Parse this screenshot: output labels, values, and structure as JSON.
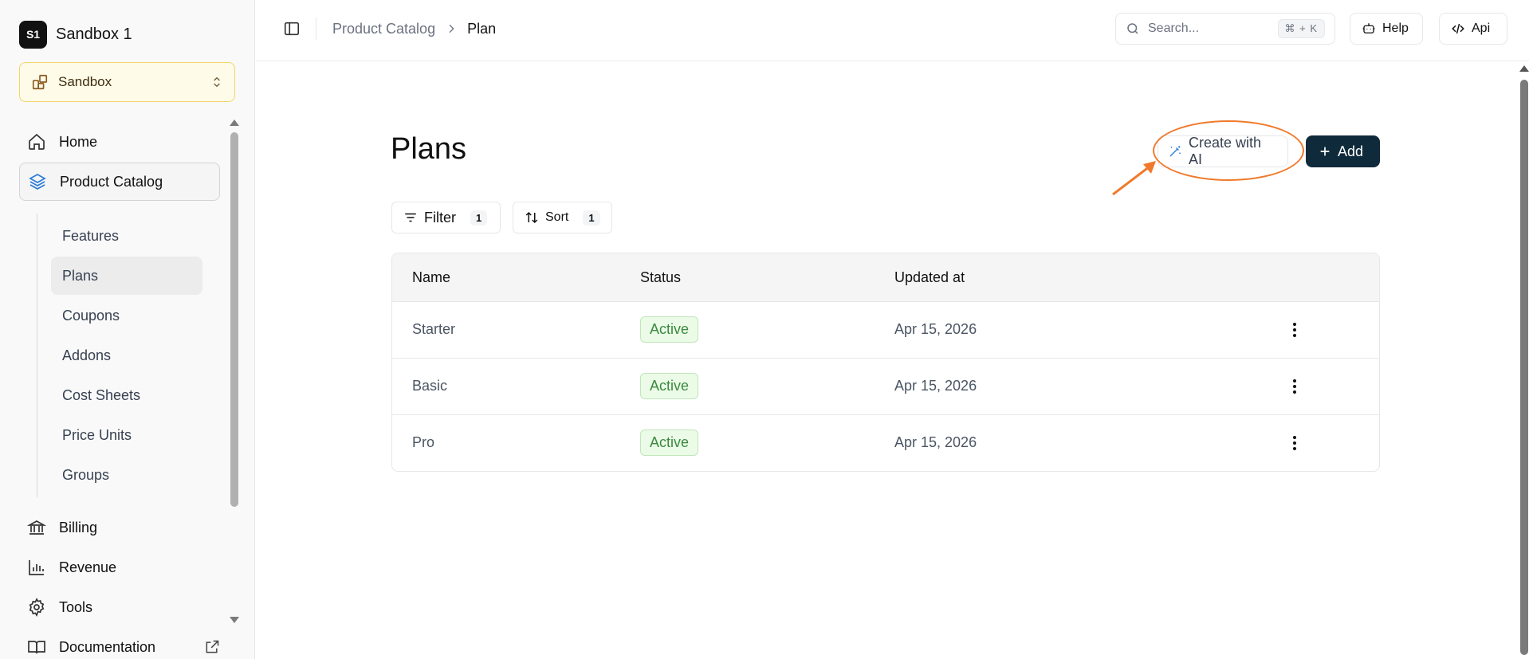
{
  "sidebar": {
    "org_initials": "S1",
    "org_name": "Sandbox 1",
    "environment": "Sandbox",
    "items": [
      {
        "label": "Home",
        "icon": "home-icon"
      },
      {
        "label": "Product Catalog",
        "icon": "layers-icon"
      },
      {
        "label": "Billing",
        "icon": "bank-icon"
      },
      {
        "label": "Revenue",
        "icon": "bar-chart-icon"
      },
      {
        "label": "Tools",
        "icon": "gear-icon"
      },
      {
        "label": "Documentation",
        "icon": "book-icon"
      }
    ],
    "sub_items": [
      "Features",
      "Plans",
      "Coupons",
      "Addons",
      "Cost Sheets",
      "Price Units",
      "Groups"
    ],
    "active_sub": "Plans"
  },
  "topbar": {
    "breadcrumb_parent": "Product Catalog",
    "breadcrumb_current": "Plan",
    "search_placeholder": "Search...",
    "search_shortcut": "⌘ + K",
    "help_label": "Help",
    "api_label": "Api"
  },
  "main": {
    "title": "Plans",
    "create_ai_label": "Create with AI",
    "add_label": "Add",
    "filter_label": "Filter",
    "filter_count": "1",
    "sort_label": "Sort",
    "sort_count": "1",
    "table": {
      "headers": [
        "Name",
        "Status",
        "Updated at"
      ],
      "rows": [
        {
          "name": "Starter",
          "status": "Active",
          "updated": "Apr 15, 2026"
        },
        {
          "name": "Basic",
          "status": "Active",
          "updated": "Apr 15, 2026"
        },
        {
          "name": "Pro",
          "status": "Active",
          "updated": "Apr 15, 2026"
        }
      ]
    }
  },
  "colors": {
    "primary_button": "#0f2a3a",
    "annotation": "#f07a2b",
    "status_active": "#3a8a3f",
    "env_highlight": "#fefbe8"
  }
}
